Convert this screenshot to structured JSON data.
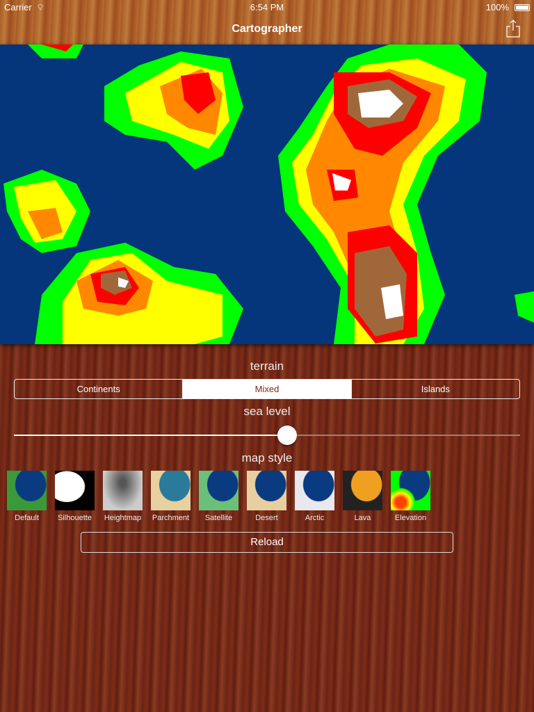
{
  "status": {
    "carrier": "Carrier",
    "time": "6:54 PM",
    "battery": "100%"
  },
  "nav": {
    "title": "Cartographer",
    "share_icon": "share-icon"
  },
  "colors": {
    "sea": "#05357a",
    "accent": "#ffffff"
  },
  "terrain": {
    "label": "terrain",
    "options": [
      "Continents",
      "Mixed",
      "Islands"
    ],
    "selected": "Mixed"
  },
  "sea_level": {
    "label": "sea level",
    "value": 0.54
  },
  "map_style": {
    "label": "map style",
    "styles": [
      "Default",
      "Silhouette",
      "Heightmap",
      "Parchment",
      "Satellite",
      "Desert",
      "Arctic",
      "Lava",
      "Elevation"
    ],
    "selected": "Elevation"
  },
  "reload_label": "Reload"
}
